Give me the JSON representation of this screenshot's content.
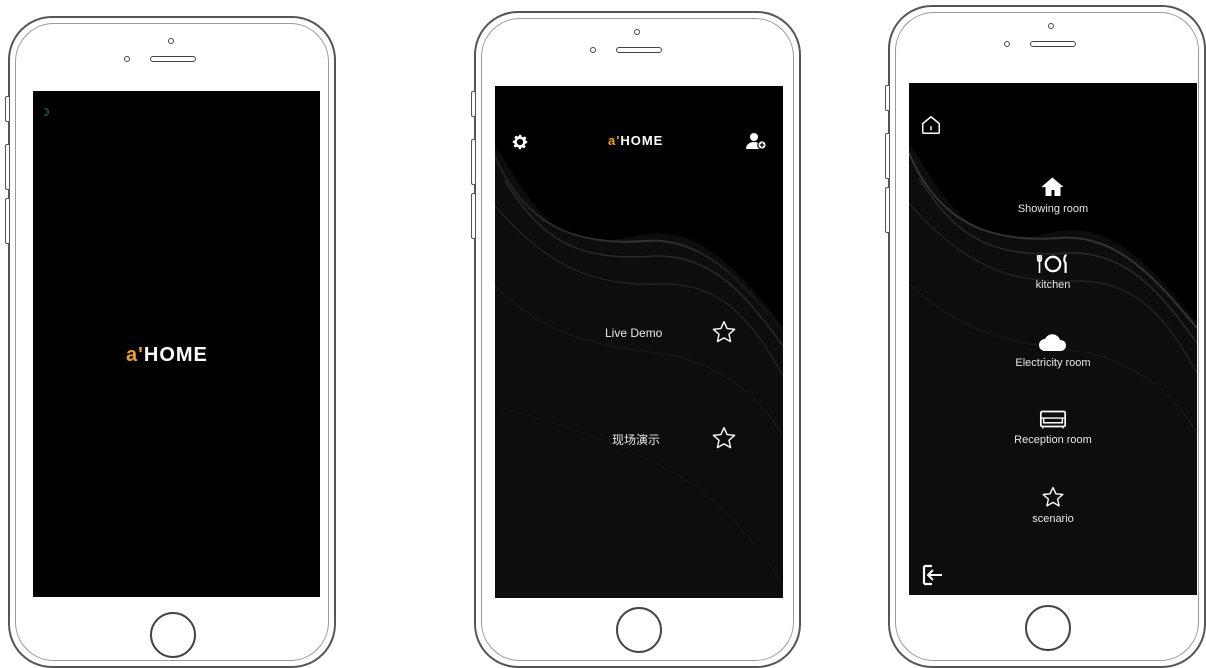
{
  "brand": {
    "mark": "a'",
    "word": "HOME",
    "mark_color": "#f0a020"
  },
  "splash": {
    "loader_glyph": "☽"
  },
  "home": {
    "icons": {
      "settings": "gear-icon",
      "add_user": "user-plus-icon"
    },
    "items": [
      {
        "label": "Live Demo",
        "icon": "star-outline-icon"
      },
      {
        "label": "现场演示",
        "icon": "star-outline-icon"
      }
    ]
  },
  "rooms": {
    "icons": {
      "home": "house-outline-icon",
      "exit": "exit-icon"
    },
    "items": [
      {
        "label": "Showing room",
        "icon": "house-filled-icon"
      },
      {
        "label": "kitchen",
        "icon": "fork-plate-knife-icon"
      },
      {
        "label": "Electricity room",
        "icon": "cloud-icon"
      },
      {
        "label": "Reception room",
        "icon": "sofa-icon"
      },
      {
        "label": "scenario",
        "icon": "star-outline-icon"
      }
    ]
  }
}
